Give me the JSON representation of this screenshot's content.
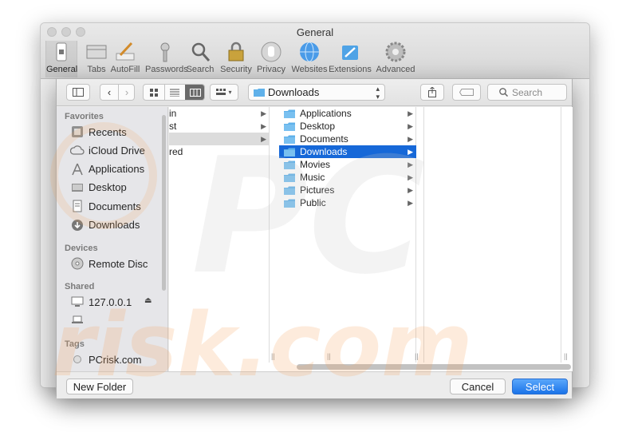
{
  "prefs": {
    "title": "General",
    "tabs": [
      {
        "label": "General",
        "icon": "switch-icon"
      },
      {
        "label": "Tabs",
        "icon": "tabs-icon"
      },
      {
        "label": "AutoFill",
        "icon": "pencil-icon"
      },
      {
        "label": "Passwords",
        "icon": "key-icon"
      },
      {
        "label": "Search",
        "icon": "magnifier-icon"
      },
      {
        "label": "Security",
        "icon": "lock-icon"
      },
      {
        "label": "Privacy",
        "icon": "hand-icon"
      },
      {
        "label": "Websites",
        "icon": "globe-icon"
      },
      {
        "label": "Extensions",
        "icon": "puzzle-icon"
      },
      {
        "label": "Advanced",
        "icon": "gear-icon"
      }
    ]
  },
  "dialog": {
    "path_popup": "Downloads",
    "search_placeholder": "Search",
    "sidebar": {
      "favorites_heading": "Favorites",
      "favorites": [
        {
          "label": "Recents",
          "icon": "recents-icon"
        },
        {
          "label": "iCloud Drive",
          "icon": "cloud-icon"
        },
        {
          "label": "Applications",
          "icon": "applications-icon"
        },
        {
          "label": "Desktop",
          "icon": "desktop-icon"
        },
        {
          "label": "Documents",
          "icon": "documents-icon"
        },
        {
          "label": "Downloads",
          "icon": "download-icon"
        }
      ],
      "devices_heading": "Devices",
      "devices": [
        {
          "label": "Remote Disc",
          "icon": "disc-icon"
        }
      ],
      "shared_heading": "Shared",
      "shared": [
        {
          "label": "127.0.0.1",
          "icon": "monitor-icon"
        },
        {
          "label": "",
          "icon": "laptop-icon"
        }
      ],
      "tags_heading": "Tags",
      "tags": [
        {
          "label": "PCrisk.com",
          "icon": "tag-dot-icon"
        }
      ]
    },
    "column1": [
      {
        "label": "in",
        "state": "normal"
      },
      {
        "label": "st",
        "state": "normal"
      },
      {
        "label": "",
        "state": "dim"
      },
      {
        "label": "red",
        "state": "normal"
      }
    ],
    "column2": [
      {
        "label": "Applications",
        "state": "normal"
      },
      {
        "label": "Desktop",
        "state": "normal"
      },
      {
        "label": "Documents",
        "state": "normal"
      },
      {
        "label": "Downloads",
        "state": "selected"
      },
      {
        "label": "Movies",
        "state": "normal"
      },
      {
        "label": "Music",
        "state": "normal"
      },
      {
        "label": "Pictures",
        "state": "normal"
      },
      {
        "label": "Public",
        "state": "normal"
      }
    ],
    "buttons": {
      "new_folder": "New Folder",
      "cancel": "Cancel",
      "select": "Select"
    }
  },
  "watermark": {
    "line1": "PC",
    "line2": "risk.com"
  },
  "colors": {
    "selection": "#1668d8",
    "folder": "#5fb1ea",
    "primary_button": "#1a73e8",
    "watermark": "#f4a460"
  }
}
